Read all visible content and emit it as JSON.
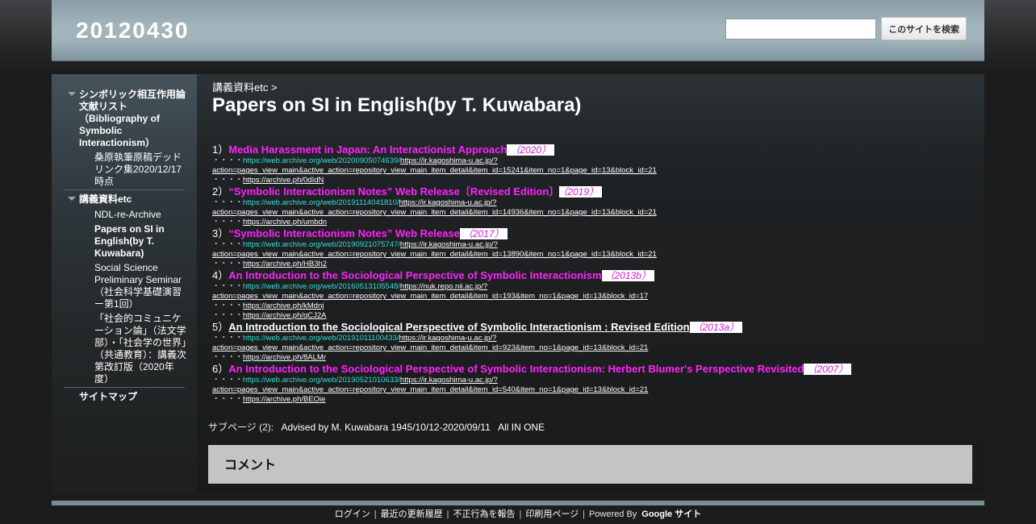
{
  "header": {
    "site_title": "20120430",
    "search_placeholder": "",
    "search_button": "このサイトを検索"
  },
  "sidebar": {
    "items": [
      {
        "label": "シンボリック相互作用論文献リスト（Bibliography of Symbolic Interactionism）",
        "children": [
          {
            "label": "桑原執筆原稿デッドリンク集2020/12/17時点"
          }
        ]
      },
      {
        "label": "講義資料etc",
        "children": [
          {
            "label": "NDL-re-Archive"
          },
          {
            "label": "Papers on SI in English(by T. Kuwabara)"
          },
          {
            "label": "Social Science Preliminary Seminar（社会科学基礎演習ー第1回）"
          },
          {
            "label": "「社会的コミュニケーション論」（法文学部）・「社会学の世界」（共通教育）：講義次第改訂版（2020年度）"
          }
        ]
      },
      {
        "label": "サイトマップ",
        "children": []
      }
    ]
  },
  "breadcrumb": {
    "parent": "講義資料etc",
    "sep": ">"
  },
  "page_title": "Papers on SI in English(by T. Kuwabara)",
  "entries": [
    {
      "num": "1）",
      "title": "Media Harassment in Japan: An Interactionist Approach",
      "year": "（2020）",
      "links": [
        {
          "dots": "・・・・",
          "arch": "https://web.archive.org/web/20200905074639/",
          "url": "https://ir.kagoshima-u.ac.jp/?",
          "cont": "action=pages_view_main&active_action=repository_view_main_item_detail&item_id=15241&item_no=1&page_id=13&block_id=21"
        },
        {
          "dots": "・・・・",
          "arch": "",
          "url": "https://archive.ph/0dIdN",
          "cont": ""
        }
      ]
    },
    {
      "num": "2）",
      "title": "“Symbolic Interactionism Notes” Web Release〔Revised Edition〕",
      "year": "（2019）",
      "links": [
        {
          "dots": "・・・・",
          "arch": "https://web.archive.org/web/20191114041810/",
          "url": "https://ir.kagoshima-u.ac.jp/?",
          "cont": "action=pages_view_main&active_action=repository_view_main_item_detail&item_id=14936&item_no=1&page_id=13&block_id=21"
        },
        {
          "dots": "・・・・",
          "arch": "",
          "url": "https://archive.ph/umbdn",
          "cont": ""
        }
      ]
    },
    {
      "num": "3）",
      "title": "“Symbolic Interactionism Notes” Web Release",
      "year": "（2017）",
      "links": [
        {
          "dots": "・・・・",
          "arch": "https://web.archive.org/web/20190921075747/",
          "url": "https://ir.kagoshima-u.ac.jp/?",
          "cont": "action=pages_view_main&active_action=repository_view_main_item_detail&item_id=13890&item_no=1&page_id=13&block_id=21"
        },
        {
          "dots": "・・・・",
          "arch": "",
          "url": "https://archive.ph/HB3h2",
          "cont": ""
        }
      ]
    },
    {
      "num": "4）",
      "title": "An Introduction to the Sociological Perspective of Symbolic Interactionism",
      "year": "（2013b）",
      "links": [
        {
          "dots": "・・・・",
          "arch": "https://web.archive.org/web/20160513105548/",
          "url": "https://nuk.repo.nii.ac.jp/?",
          "cont": "action=pages_view_main&active_action=repository_view_main_item_detail&item_id=193&item_no=1&page_id=13&block_id=17"
        },
        {
          "dots": "・・・・",
          "arch": "",
          "url": "https://archive.ph/kMdnj",
          "cont": ""
        },
        {
          "dots": "・・・・",
          "arch": "",
          "url": "https://archive.ph/qCJ2A",
          "cont": ""
        }
      ]
    },
    {
      "num": "5）",
      "title": "An Introduction to the Sociological Perspective of Symbolic Interactionism : Revised Edition",
      "year": "（2013a）",
      "white": true,
      "links": [
        {
          "dots": "・・・・",
          "arch": "https://web.archive.org/web/20191011100433/",
          "url": "https://ir.kagoshima-u.ac.jp/?",
          "cont": "action=pages_view_main&active_action=repository_view_main_item_detail&item_id=923&item_no=1&page_id=13&block_id=21"
        },
        {
          "dots": "・・・・",
          "arch": "",
          "url": "https://archive.ph/8ALMr",
          "cont": ""
        }
      ]
    },
    {
      "num": "6）",
      "title": "An Introduction to the Sociological Perspective of Symbolic Interactionism: Herbert Blumer's Perspective Revisited",
      "year": "（2007）",
      "links": [
        {
          "dots": "・・・・",
          "arch": "https://web.archive.org/web/20190521010633/",
          "url": "https://ir.kagoshima-u.ac.jp/?",
          "cont": "action=pages_view_main&active_action=repository_view_main_item_detail&item_id=540&item_no=1&page_id=13&block_id=21"
        },
        {
          "dots": "・・・・",
          "arch": "",
          "url": "https://archive.ph/BEOie",
          "cont": ""
        }
      ]
    }
  ],
  "subpages": {
    "label": "サブページ (2):",
    "links": [
      "Advised by M. Kuwabara 1945/10/12-2020/09/11",
      "All IN ONE"
    ]
  },
  "comment": {
    "title": "コメント"
  },
  "footer": {
    "login": "ログイン",
    "recent": "最近の更新履歴",
    "report": "不正行為を報告",
    "print": "印刷用ページ",
    "powered": "Powered By",
    "google": "Google サイト",
    "sep": "|"
  }
}
